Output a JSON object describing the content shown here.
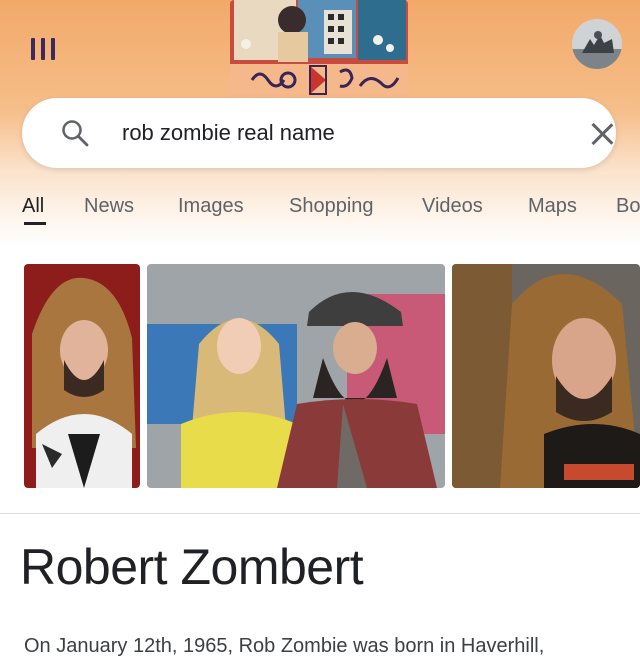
{
  "search": {
    "query": "rob zombie real name"
  },
  "tabs": [
    {
      "label": "All",
      "active": true
    },
    {
      "label": "News"
    },
    {
      "label": "Images"
    },
    {
      "label": "Shopping"
    },
    {
      "label": "Videos"
    },
    {
      "label": "Maps"
    },
    {
      "label": "Bo"
    }
  ],
  "result": {
    "title": "Robert Zombert",
    "snippet": "On January 12th, 1965, Rob Zombie was born in Haverhill,"
  },
  "colors": {
    "header_top": "#f2a968",
    "header_bottom": "#ffffff",
    "menu_icon": "#3c2a5e",
    "text_primary": "#202124",
    "text_secondary": "#5f6368"
  }
}
